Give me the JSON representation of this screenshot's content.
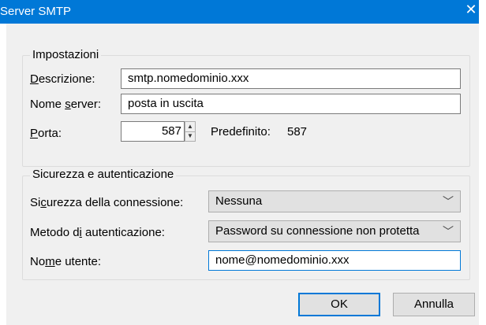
{
  "window": {
    "title": "Server SMTP",
    "close_glyph": "✕"
  },
  "settings": {
    "legend": "Impostazioni",
    "description": {
      "label_prefix": "",
      "label_accel": "D",
      "label_rest": "escrizione:",
      "value": "smtp.nomedominio.xxx"
    },
    "server_name": {
      "label_prefix": "Nome ",
      "label_accel": "s",
      "label_rest": "erver:",
      "value": "posta in uscita"
    },
    "port": {
      "label_prefix": "",
      "label_accel": "P",
      "label_rest": "orta:",
      "value": "587",
      "default_label": "Predefinito:",
      "default_value": "587"
    }
  },
  "security": {
    "legend": "Sicurezza e autenticazione",
    "connection_security": {
      "label_prefix": "Si",
      "label_accel": "c",
      "label_rest": "urezza della connessione:",
      "selected": "Nessuna"
    },
    "auth_method": {
      "label_prefix": "Metodo d",
      "label_accel": "i",
      "label_rest": " autenticazione:",
      "selected": "Password su connessione non protetta"
    },
    "username": {
      "label_prefix": "No",
      "label_accel": "m",
      "label_rest": "e utente:",
      "value": "nome@nomedominio.xxx"
    }
  },
  "buttons": {
    "ok": "OK",
    "cancel": "Annulla"
  }
}
